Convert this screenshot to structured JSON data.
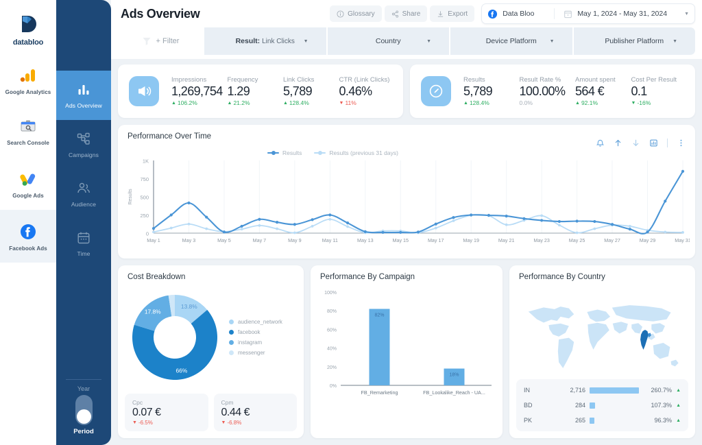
{
  "sources": {
    "logo_text": "databloo",
    "items": [
      {
        "label": "Google Analytics",
        "icon": "google-analytics-icon",
        "active": false
      },
      {
        "label": "Search Console",
        "icon": "search-console-icon",
        "active": false
      },
      {
        "label": "Google Ads",
        "icon": "google-ads-icon",
        "active": false
      },
      {
        "label": "Facebook Ads",
        "icon": "facebook-ads-icon",
        "active": true
      }
    ]
  },
  "nav": {
    "items": [
      {
        "label": "Ads Overview",
        "icon": "bar-chart-icon",
        "active": true
      },
      {
        "label": "Campaigns",
        "icon": "sitemap-icon",
        "active": false
      },
      {
        "label": "Audience",
        "icon": "people-icon",
        "active": false
      },
      {
        "label": "Time",
        "icon": "calendar-icon",
        "active": false
      }
    ],
    "toggle": {
      "top_label": "Year",
      "bottom_label": "Period",
      "state": "Period"
    }
  },
  "header": {
    "title": "Ads Overview",
    "actions": [
      {
        "label": "Glossary",
        "icon": "info-icon"
      },
      {
        "label": "Share",
        "icon": "share-icon"
      },
      {
        "label": "Export",
        "icon": "download-icon"
      }
    ],
    "account": {
      "name": "Data Bloo",
      "icon": "facebook-icon"
    },
    "date_range": "May 1, 2024 - May 31, 2024",
    "date_icon": "calendar-icon"
  },
  "filters": {
    "add_label": "+ Filter",
    "filter_icon": "funnel-icon",
    "items": [
      {
        "name": "Result:",
        "value": "Link Clicks"
      },
      {
        "name": "Country",
        "value": ""
      },
      {
        "name": "Device Platform",
        "value": ""
      },
      {
        "name": "Publisher Platform",
        "value": ""
      }
    ]
  },
  "kpis": [
    {
      "icon": "megaphone-icon",
      "metrics": [
        {
          "label": "Impressions",
          "value": "1,269,754",
          "delta": "106.2%",
          "dir": "up"
        },
        {
          "label": "Frequency",
          "value": "1.29",
          "delta": "21.2%",
          "dir": "up"
        },
        {
          "label": "Link Clicks",
          "value": "5,789",
          "delta": "128.4%",
          "dir": "up"
        },
        {
          "label": "CTR (Link Clicks)",
          "value": "0.46%",
          "delta": "11%",
          "dir": "down"
        }
      ]
    },
    {
      "icon": "gauge-icon",
      "metrics": [
        {
          "label": "Results",
          "value": "5,789",
          "delta": "128.4%",
          "dir": "up"
        },
        {
          "label": "Result Rate %",
          "value": "100.00%",
          "delta": "0.0%",
          "dir": "flat"
        },
        {
          "label": "Amount spent",
          "value": "564 €",
          "delta": "92.1%",
          "dir": "up"
        },
        {
          "label": "Cost Per Result",
          "value": "0.1",
          "delta": "-16%",
          "dir": "up"
        }
      ]
    }
  ],
  "performance": {
    "title": "Performance Over Time",
    "tools": [
      "bell-icon",
      "arrow-up-icon",
      "arrow-down-icon",
      "chart-export-icon",
      "more-vertical-icon"
    ],
    "chart_data": {
      "type": "line",
      "title": "Performance Over Time",
      "xlabel": "",
      "ylabel": "Results",
      "ylim": [
        0,
        1000
      ],
      "yticks": [
        0,
        250,
        500,
        750,
        1000
      ],
      "ytick_labels": [
        "0",
        "250",
        "500",
        "750",
        "1K"
      ],
      "grid": true,
      "legend_position": "top-left",
      "x": [
        "May 1",
        "May 2",
        "May 3",
        "May 4",
        "May 5",
        "May 6",
        "May 7",
        "May 8",
        "May 9",
        "May 10",
        "May 11",
        "May 12",
        "May 13",
        "May 14",
        "May 15",
        "May 16",
        "May 17",
        "May 18",
        "May 19",
        "May 20",
        "May 21",
        "May 22",
        "May 23",
        "May 24",
        "May 25",
        "May 26",
        "May 27",
        "May 28",
        "May 29",
        "May 30",
        "May 31"
      ],
      "xtick_labels": [
        "May 1",
        "May 3",
        "May 5",
        "May 7",
        "May 9",
        "May 11",
        "May 13",
        "May 15",
        "May 17",
        "May 19",
        "May 21",
        "May 23",
        "May 25",
        "May 27",
        "May 29",
        "May 31"
      ],
      "series": [
        {
          "name": "Results",
          "color": "#4a95d6",
          "values": [
            65,
            250,
            415,
            220,
            15,
            95,
            190,
            150,
            120,
            185,
            250,
            140,
            20,
            10,
            10,
            15,
            125,
            215,
            250,
            245,
            235,
            200,
            175,
            160,
            165,
            160,
            120,
            55,
            15,
            440,
            850
          ]
        },
        {
          "name": "Results (previous 31 days)",
          "color": "#b9dcf6",
          "values": [
            15,
            70,
            125,
            60,
            20,
            55,
            105,
            60,
            5,
            95,
            190,
            90,
            5,
            30,
            30,
            5,
            70,
            170,
            245,
            240,
            115,
            175,
            240,
            110,
            5,
            60,
            110,
            95,
            40,
            15,
            10
          ]
        }
      ]
    }
  },
  "cost_breakdown": {
    "title": "Cost Breakdown",
    "chart_data": {
      "type": "pie",
      "title": "Cost Breakdown",
      "labels": [
        "audience_network",
        "facebook",
        "instagram",
        "messenger"
      ],
      "values": [
        13.8,
        66.0,
        17.8,
        2.4
      ],
      "value_labels": [
        "13.8%",
        "66%",
        "17.8%",
        ""
      ],
      "colors": [
        "#a9d6f5",
        "#1c82c9",
        "#62aee4",
        "#cfe7f8"
      ],
      "legend_position": "right"
    },
    "mini_cards": [
      {
        "label": "Cpc",
        "value": "0.07 €",
        "delta": "-6.5%",
        "dir": "down"
      },
      {
        "label": "Cpm",
        "value": "0.44 €",
        "delta": "-6.8%",
        "dir": "down"
      }
    ]
  },
  "campaign": {
    "title": "Performance By Campaign",
    "chart_data": {
      "type": "bar",
      "title": "Performance By Campaign",
      "categories": [
        "FB_Remarketing",
        "FB_Lookalike_Reach - UA..."
      ],
      "values": [
        82,
        18
      ],
      "value_labels": [
        "82%",
        "18%"
      ],
      "ylim": [
        0,
        100
      ],
      "yticks": [
        0,
        20,
        40,
        60,
        80,
        100
      ],
      "ytick_labels": [
        "0%",
        "20%",
        "40%",
        "60%",
        "80%",
        "100%"
      ],
      "bar_color": "#62aee4",
      "grid": false
    }
  },
  "country": {
    "title": "Performance By Country",
    "map_highlight": "India",
    "chart_data": {
      "type": "table",
      "title": "Performance By Country",
      "columns": [
        "country",
        "results",
        "change"
      ],
      "rows": [
        {
          "code": "IN",
          "value": "2,716",
          "num": 2716,
          "pct": "260.7%",
          "dir": "up"
        },
        {
          "code": "BD",
          "value": "284",
          "num": 284,
          "pct": "107.3%",
          "dir": "up"
        },
        {
          "code": "PK",
          "value": "265",
          "num": 265,
          "pct": "96.3%",
          "dir": "up"
        }
      ]
    }
  }
}
